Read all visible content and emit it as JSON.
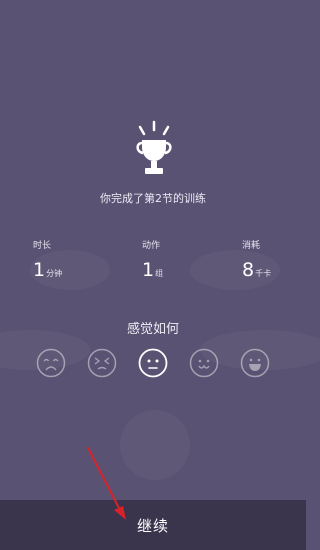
{
  "accent_color": "#5a5272",
  "bar_color": "#3b344d",
  "annotation_color": "#d8232a",
  "result": {
    "message": "你完成了第2节的训练"
  },
  "stats": {
    "duration": {
      "label": "时长",
      "value": "1",
      "unit": "分钟"
    },
    "actions": {
      "label": "动作",
      "value": "1",
      "unit": "组"
    },
    "calories": {
      "label": "消耗",
      "value": "8",
      "unit": "千卡"
    }
  },
  "feeling": {
    "title": "感觉如何",
    "options": [
      "very-bad-face-icon",
      "bad-face-icon",
      "neutral-face-icon",
      "good-face-icon",
      "very-good-face-icon"
    ],
    "selected": "neutral-face-icon"
  },
  "footer": {
    "continue_label": "继续"
  }
}
